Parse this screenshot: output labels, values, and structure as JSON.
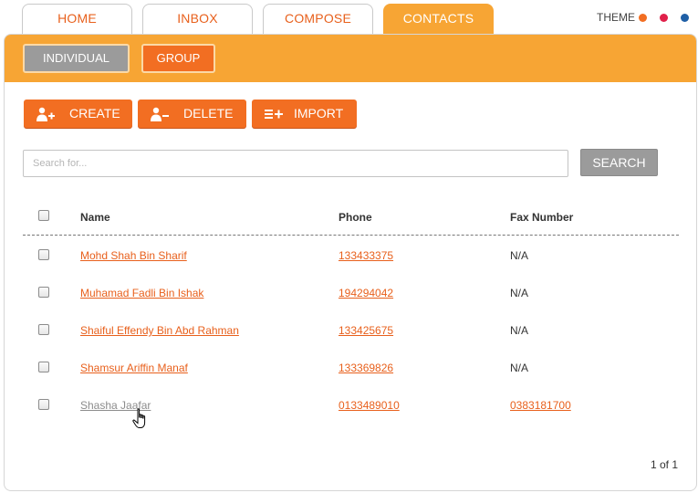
{
  "tabs": [
    {
      "label": "HOME",
      "active": false
    },
    {
      "label": "INBOX",
      "active": false
    },
    {
      "label": "COMPOSE",
      "active": false
    },
    {
      "label": "CONTACTS",
      "active": true
    }
  ],
  "theme": {
    "label": "THEME",
    "colors": [
      "#f26e22",
      "#e0204a",
      "#1f5fa6"
    ]
  },
  "subnav": {
    "individual": "INDIVIDUAL",
    "group": "GROUP"
  },
  "actions": {
    "create": "CREATE",
    "delete": "DELETE",
    "import": "IMPORT"
  },
  "search": {
    "placeholder": "Search for...",
    "button": "SEARCH"
  },
  "table": {
    "columns": {
      "name": "Name",
      "phone": "Phone",
      "fax": "Fax Number"
    },
    "rows": [
      {
        "name": "Mohd Shah Bin Sharif",
        "phone": "133433375",
        "fax": "N/A"
      },
      {
        "name": "Muhamad Fadli Bin Ishak",
        "phone": "194294042",
        "fax": "N/A"
      },
      {
        "name": "Shaiful Effendy Bin Abd Rahman",
        "phone": "133425675",
        "fax": "N/A"
      },
      {
        "name": "Shamsur Ariffin Manaf",
        "phone": "133369826",
        "fax": "N/A"
      },
      {
        "name": "Shasha Jaafar",
        "phone": "0133489010",
        "fax": "0383181700"
      }
    ]
  },
  "pager": "1 of 1",
  "colors": {
    "accent": "#f7a534",
    "button": "#f26e22",
    "gray": "#9b9b9b"
  }
}
